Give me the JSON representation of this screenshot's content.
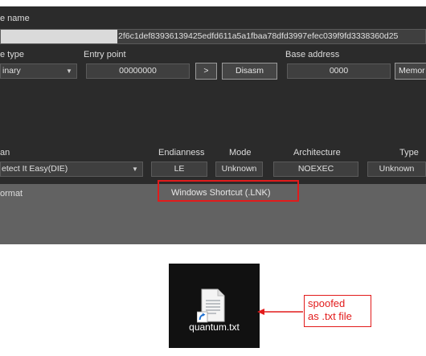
{
  "file_name": {
    "label": "e name",
    "value": "2f6c1def83936139425edfd611a5a1fbaa78dfd3997efec039f9fd3338360d25"
  },
  "file_type": {
    "label": "e type",
    "value": "inary"
  },
  "entry_point": {
    "label": "Entry point",
    "value": "00000000",
    "next_button": ">",
    "disasm_button": "Disasm"
  },
  "base_address": {
    "label": "Base address",
    "value": "0000",
    "memory_button": "Memor"
  },
  "scan": {
    "label": "an",
    "value": "etect It Easy(DIE)"
  },
  "endianness": {
    "label": "Endianness",
    "value": "LE"
  },
  "mode": {
    "label": "Mode",
    "value": "Unknown"
  },
  "architecture": {
    "label": "Architecture",
    "value": "NOEXEC"
  },
  "type": {
    "label": "Type",
    "value": "Unknown"
  },
  "format": {
    "label": "ormat",
    "value": "Windows Shortcut (.LNK)"
  },
  "desktop_file": {
    "name": "quantum.txt"
  },
  "annotation": {
    "line1": "spoofed",
    "line2": "as .txt file"
  },
  "colors": {
    "highlight": "#e21b1b",
    "panel": "#2b2b2b",
    "panel_lower": "#626262"
  }
}
